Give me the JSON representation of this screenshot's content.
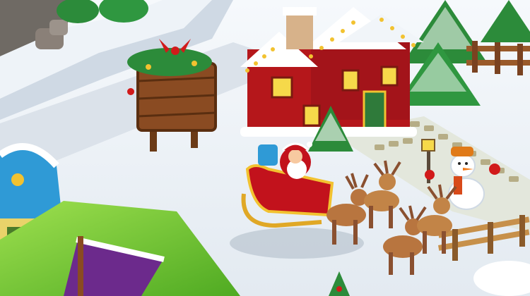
{
  "scene": {
    "title": "",
    "palette": {
      "snow": "#f4f7fb",
      "snow_shadow": "#cfd9e4",
      "path": "#d7dde4",
      "grass": "#7ccf3a",
      "house_red": "#b5171b",
      "roof_snow": "#ffffff",
      "wood": "#8a4b22",
      "tree": "#2c8b3a",
      "gold": "#f2c230",
      "blue_roof": "#2f9ad6",
      "sleigh_red": "#c2121c",
      "reindeer": "#b8753f"
    },
    "objects": {
      "gingerbread_house": "house-icon",
      "signboard": "signboard-icon",
      "santa_sleigh": "santa-sleigh-icon",
      "reindeer": [
        "reindeer-icon",
        "reindeer-icon",
        "reindeer-icon",
        "reindeer-icon"
      ],
      "snowman": "snowman-icon",
      "blue_house": "blue-cottage-icon",
      "christmas_trees": [
        "tree-icon",
        "tree-icon",
        "tree-icon",
        "tree-icon",
        "tree-icon"
      ],
      "fence": "fence-icon",
      "lamp_post": "lamp-icon"
    }
  }
}
